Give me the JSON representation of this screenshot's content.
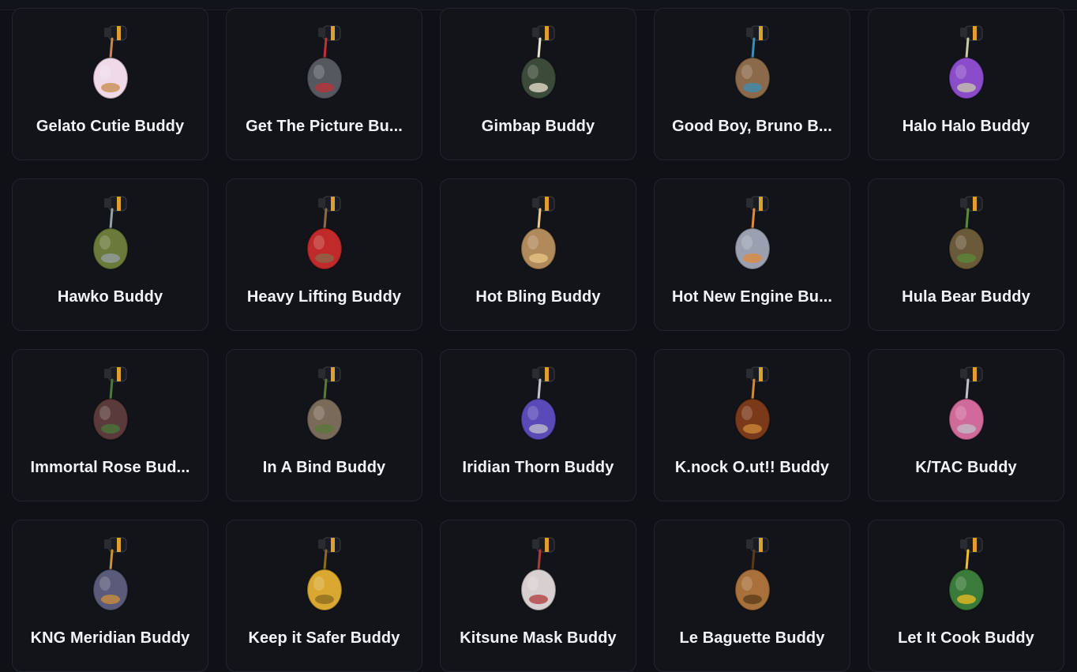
{
  "buddies": [
    {
      "name": "Gelato Cutie Buddy",
      "icon": "gelato-ice-cream-charm-icon",
      "color": "#f0d9e8",
      "accent": "#c58a4a"
    },
    {
      "name": "Get The Picture Bu...",
      "icon": "camera-charm-icon",
      "color": "#55585e",
      "accent": "#c2303a"
    },
    {
      "name": "Gimbap Buddy",
      "icon": "gimbap-roll-charm-icon",
      "color": "#3c4a3a",
      "accent": "#e8e4cf"
    },
    {
      "name": "Good Boy, Bruno B...",
      "icon": "dog-charm-icon",
      "color": "#8a6a4a",
      "accent": "#3a8fb8"
    },
    {
      "name": "Halo Halo Buddy",
      "icon": "halo-halo-dessert-charm-icon",
      "color": "#8a4cc9",
      "accent": "#c9c9a9"
    },
    {
      "name": "Hawko Buddy",
      "icon": "hawk-ring-charm-icon",
      "color": "#6a7a3a",
      "accent": "#9aa0a8"
    },
    {
      "name": "Heavy Lifting Buddy",
      "icon": "kettlebell-charm-icon",
      "color": "#c02a2a",
      "accent": "#8a6a4a"
    },
    {
      "name": "Hot Bling Buddy",
      "icon": "star-bling-charm-icon",
      "color": "#b08a5a",
      "accent": "#e9c88a"
    },
    {
      "name": "Hot New Engine Bu...",
      "icon": "rocket-charm-icon",
      "color": "#9aa0b0",
      "accent": "#e08a3a"
    },
    {
      "name": "Hula Bear Buddy",
      "icon": "hula-bear-charm-icon",
      "color": "#6a5a3a",
      "accent": "#5a8a3a"
    },
    {
      "name": "Immortal Rose Bud...",
      "icon": "rose-jar-charm-icon",
      "color": "#5a3a3a",
      "accent": "#4a7a3a"
    },
    {
      "name": "In A Bind Buddy",
      "icon": "floating-island-charm-icon",
      "color": "#7a6a5a",
      "accent": "#5a7a3a"
    },
    {
      "name": "Iridian Thorn Buddy",
      "icon": "thorn-crescent-charm-icon",
      "color": "#5a4ab8",
      "accent": "#c0c4cc"
    },
    {
      "name": "K.nock O.ut!! Buddy",
      "icon": "boombox-charm-icon",
      "color": "#7a3a1a",
      "accent": "#d08a3a"
    },
    {
      "name": "K/TAC Buddy",
      "icon": "crystal-shard-charm-icon",
      "color": "#d06a9a",
      "accent": "#c0c0c8"
    },
    {
      "name": "KNG Meridian Buddy",
      "icon": "ship-charm-icon",
      "color": "#5a5a7a",
      "accent": "#d0903a"
    },
    {
      "name": "Keep it Safer Buddy",
      "icon": "padlock-charm-icon",
      "color": "#d8a830",
      "accent": "#8a6a20"
    },
    {
      "name": "Kitsune Mask Buddy",
      "icon": "fox-mask-charm-icon",
      "color": "#d8d0d0",
      "accent": "#b03a3a"
    },
    {
      "name": "Le Baguette Buddy",
      "icon": "baguette-charm-icon",
      "color": "#a8703a",
      "accent": "#5a3a1a"
    },
    {
      "name": "Let It Cook Buddy",
      "icon": "lantern-fire-charm-icon",
      "color": "#3a7a3a",
      "accent": "#f0c020"
    }
  ],
  "clip_colors": {
    "body": "#1b1c20",
    "band": "#e0a030"
  }
}
